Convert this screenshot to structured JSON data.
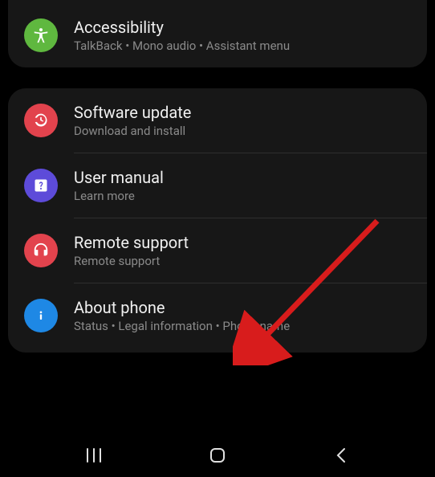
{
  "group1": {
    "accessibility": {
      "title": "Accessibility",
      "subtitle": "TalkBack  •  Mono audio  •  Assistant menu",
      "iconColor": "#5fb83f"
    }
  },
  "group2": {
    "software_update": {
      "title": "Software update",
      "subtitle": "Download and install",
      "iconColor": "#e2434d"
    },
    "user_manual": {
      "title": "User manual",
      "subtitle": "Learn more",
      "iconColor": "#5d4bd9"
    },
    "remote_support": {
      "title": "Remote support",
      "subtitle": "Remote support",
      "iconColor": "#e2434d"
    },
    "about_phone": {
      "title": "About phone",
      "subtitle": "Status  •  Legal information  •  Phone name",
      "iconColor": "#1e88e5"
    }
  }
}
